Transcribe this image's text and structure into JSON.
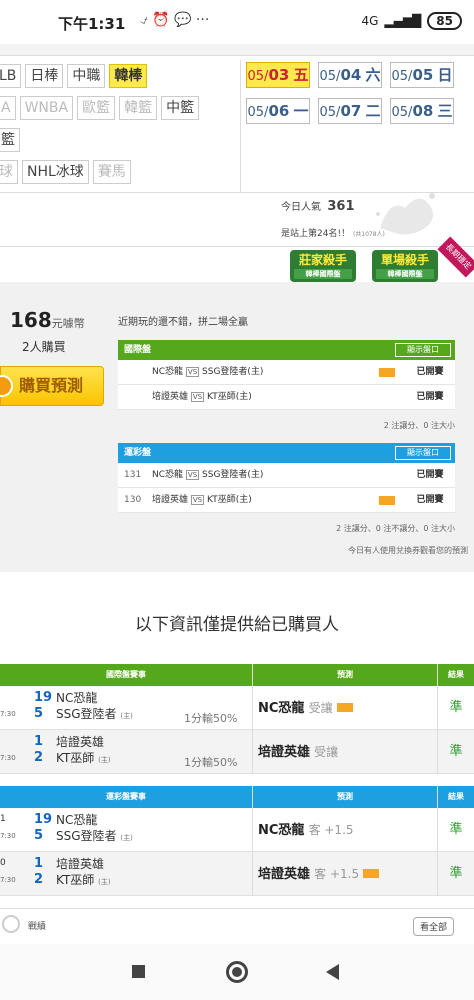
{
  "status": {
    "time": "下午1:31",
    "icons": "⍻ ⏰ 💬 ···",
    "net": "4G",
    "battery": "85"
  },
  "categories": {
    "row1": [
      {
        "label": "LB",
        "faded": false
      },
      {
        "label": "日棒",
        "faded": false
      },
      {
        "label": "中職",
        "faded": false
      },
      {
        "label": "韓棒",
        "faded": false,
        "selected": true
      }
    ],
    "row2": [
      {
        "label": "A",
        "faded": true
      },
      {
        "label": "WNBA",
        "faded": true
      },
      {
        "label": "歐籃",
        "faded": true
      },
      {
        "label": "韓籃",
        "faded": true
      },
      {
        "label": "中籃",
        "faded": false
      }
    ],
    "row3": [
      {
        "label": "籃",
        "faded": false
      }
    ],
    "row4": [
      {
        "label": "球",
        "faded": true
      },
      {
        "label": "NHL冰球",
        "faded": false
      },
      {
        "label": "賽馬",
        "faded": true
      }
    ]
  },
  "dates": [
    {
      "md": "05/",
      "day": "03",
      "wd": "五",
      "selected": true
    },
    {
      "md": "05/",
      "day": "04",
      "wd": "六",
      "selected": false
    },
    {
      "md": "05/",
      "day": "05",
      "wd": "日",
      "selected": false
    },
    {
      "md": "05/",
      "day": "06",
      "wd": "一",
      "selected": false
    },
    {
      "md": "05/",
      "day": "07",
      "wd": "二",
      "selected": false
    },
    {
      "md": "05/",
      "day": "08",
      "wd": "三",
      "selected": false
    }
  ],
  "popularity": {
    "label": "今日人氣",
    "value": "361",
    "rank": "是站上第24名!！",
    "rank_note": "(共1078人)"
  },
  "badges": {
    "b1": "莊家殺手",
    "b1_sub": "韓棒國際盤",
    "b2": "單場殺手",
    "b2_sub": "韓棒國際盤",
    "ribbon": "長期穩定"
  },
  "purchase": {
    "price": "168",
    "unit": "元噱幣",
    "buyers": "2人購買",
    "buy_label": "購買預測"
  },
  "note": "近期玩的還不錯，拼二場全贏",
  "intl": {
    "title": "國際盤",
    "btn": "顯示盤口",
    "rows": [
      {
        "num": "",
        "home": "NC恐龍",
        "away": "SSG登陸者(主)",
        "status": "已開賽",
        "icon": true
      },
      {
        "num": "",
        "home": "培證英雄",
        "away": "KT巫師(主)",
        "status": "已開賽",
        "icon": false
      }
    ],
    "summary": "2 注讓分、0 注大小"
  },
  "lottery": {
    "title": "運彩盤",
    "btn": "顯示盤口",
    "rows": [
      {
        "num": "131",
        "home": "NC恐龍",
        "away": "SSG登陸者(主)",
        "status": "已開賽",
        "icon": false
      },
      {
        "num": "130",
        "home": "培證英雄",
        "away": "KT巫師(主)",
        "status": "已開賽",
        "icon": true
      }
    ],
    "summary": "2 注讓分、0 注不讓分、0 注大小",
    "exchange_note": "今日有人使用兌換券觀看您的預測"
  },
  "info_text": "以下資訊僅提供給已購買人",
  "intl_results": {
    "h_game": "國際盤賽事",
    "h_pred": "預測",
    "h_res": "結果",
    "rows": [
      {
        "time": "7:30",
        "n1": "19",
        "n2": "5",
        "t1": "NC恐龍",
        "t2": "SSG登陸者",
        "host": "(主)",
        "odds": "1分輸50%",
        "pick": "NC恐龍",
        "pick_type": "受讓",
        "icon": true,
        "result": "準"
      },
      {
        "time": "7:30",
        "n1": "1",
        "n2": "2",
        "t1": "培證英雄",
        "t2": "KT巫師",
        "host": "(主)",
        "odds": "1分輸50%",
        "pick": "培證英雄",
        "pick_type": "受讓",
        "icon": false,
        "result": "準"
      }
    ]
  },
  "lottery_results": {
    "h_game": "運彩盤賽事",
    "h_pred": "預測",
    "h_res": "結果",
    "rows": [
      {
        "time": "7:30",
        "tpre": "1",
        "n1": "19",
        "n2": "5",
        "t1": "NC恐龍",
        "t2": "SSG登陸者",
        "host": "(主)",
        "pick": "NC恐龍",
        "pick_type": "客 +1.5",
        "icon": false,
        "result": "準"
      },
      {
        "time": "7:30",
        "tpre": "0",
        "n1": "1",
        "n2": "2",
        "t1": "培證英雄",
        "t2": "KT巫師",
        "host": "(主)",
        "pick": "培證英雄",
        "pick_type": "客 +1.5",
        "icon": true,
        "result": "準"
      }
    ]
  },
  "footer": {
    "label": "戰績",
    "all": "看全部"
  },
  "colors": {
    "green": "#55a81c",
    "blue": "#1ea0e0",
    "yellow": "#ffe94d"
  }
}
